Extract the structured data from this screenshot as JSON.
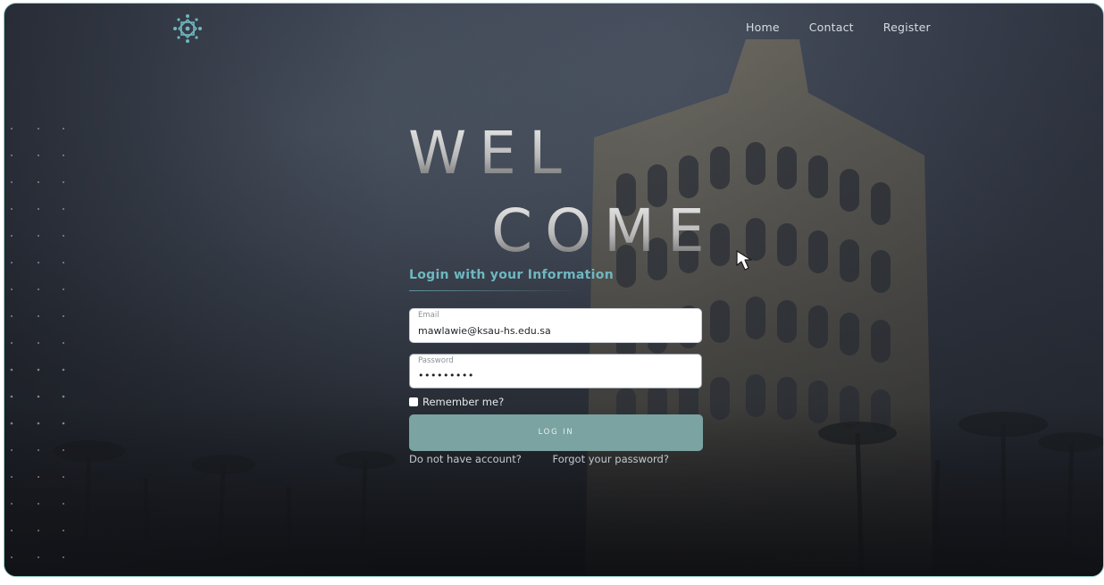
{
  "nav": {
    "items": [
      {
        "label": "Home"
      },
      {
        "label": "Contact"
      },
      {
        "label": "Register"
      }
    ]
  },
  "hero": {
    "welcome_line1": "WEL",
    "welcome_line2": "COME"
  },
  "login": {
    "subtitle": "Login with your Information",
    "email_label": "Email",
    "email_value": "mawlawie@ksau-hs.edu.sa",
    "password_label": "Password",
    "password_value": "•••••••••",
    "remember_label": "Remember me?",
    "login_button": "LOG IN",
    "no_account_link": "Do not have account?",
    "forgot_link": "Forgot your password?"
  },
  "colors": {
    "accent": "#6fb7c0",
    "button": "#7aa3a1",
    "frame_border": "#8fc9c2"
  },
  "icons": {
    "logo": "ornamental-star-logo-icon",
    "cursor": "mouse-pointer-icon"
  }
}
